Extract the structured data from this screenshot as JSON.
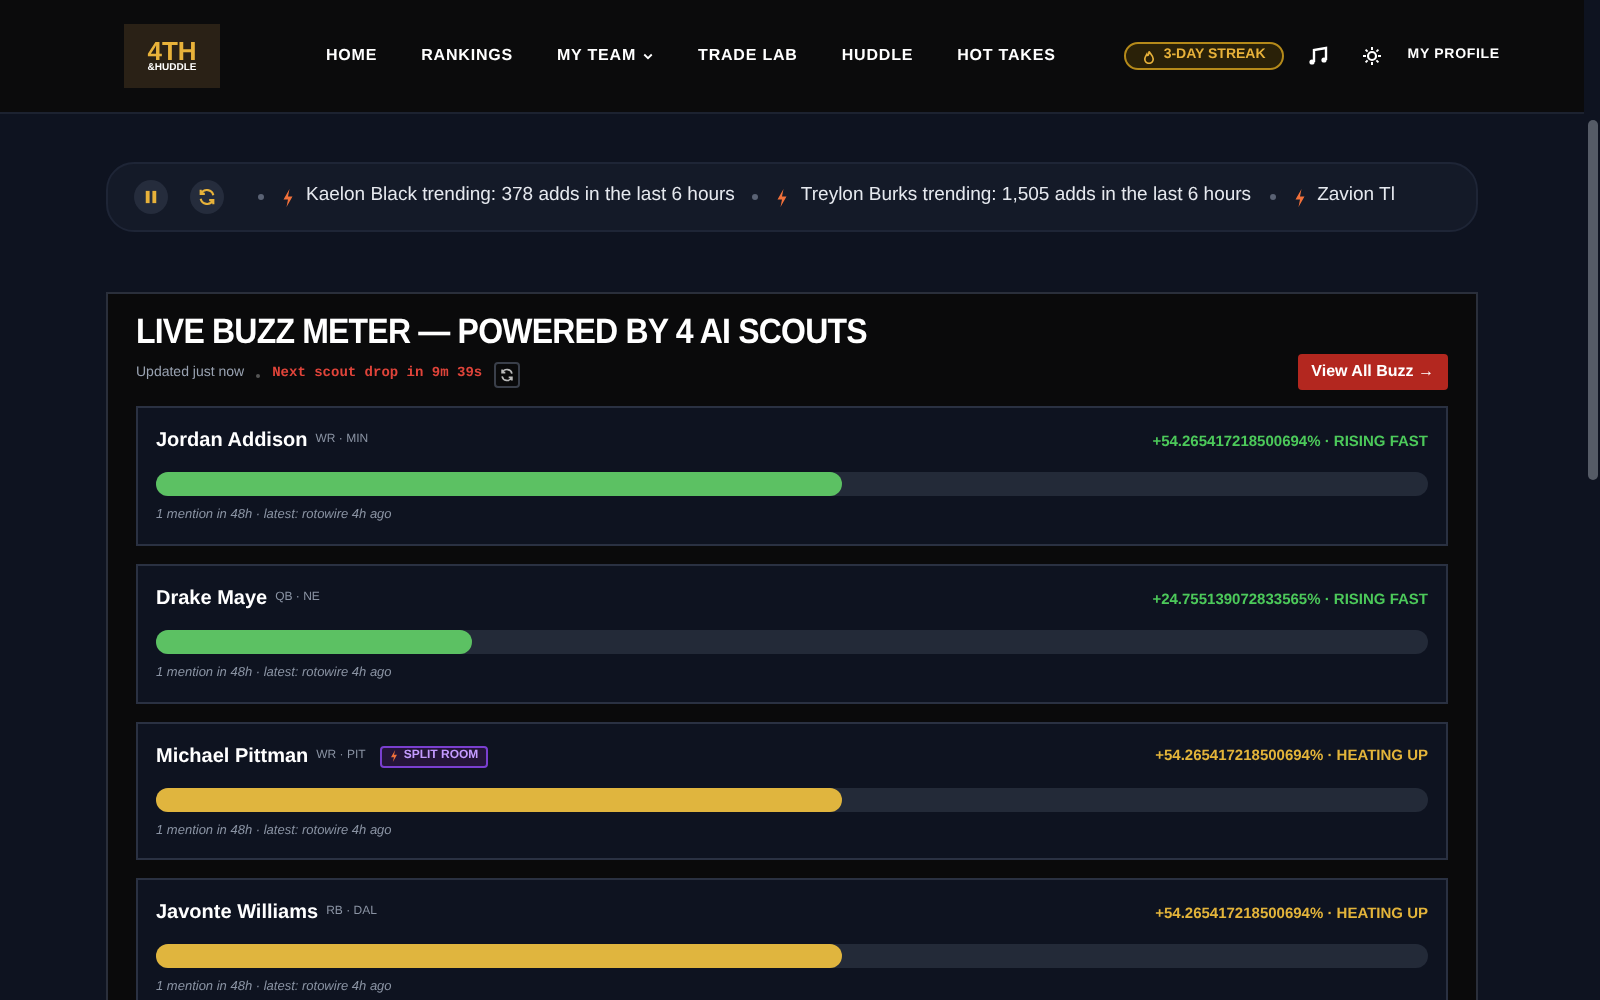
{
  "logo": {
    "line_1": "4TH",
    "line_2": "&HUDDLE"
  },
  "nav": [
    {
      "label": "HOME",
      "dropdown": false
    },
    {
      "label": "RANKINGS",
      "dropdown": false
    },
    {
      "label": "MY TEAM",
      "dropdown": true
    },
    {
      "label": "TRADE LAB",
      "dropdown": false
    },
    {
      "label": "HUDDLE",
      "dropdown": false
    },
    {
      "label": "HOT TAKES",
      "dropdown": false
    }
  ],
  "streak": "3-DAY STREAK",
  "profile": "MY PROFILE",
  "ticker": [
    {
      "text": "Kaelon Black trending: 378 adds in the last 6 hours"
    },
    {
      "text": "Treylon Burks trending: 1,505 adds in the last 6 hours"
    },
    {
      "text": "Zavion Tl"
    }
  ],
  "panel": {
    "title": "LIVE BUZZ METER — POWERED BY 4 AI SCOUTS",
    "updated": "Updated just now",
    "countdown": "Next scout drop in 9m 39s",
    "button": "View All Buzz →",
    "players": [
      {
        "name": "Jordan Addison",
        "pos": "WR · MIN",
        "change": "+54.265417218500694% · RISING FAST",
        "kind": "rising",
        "level": 0.54,
        "note": "1 mention in 48h · latest: rotowire 4h ago"
      },
      {
        "name": "Drake Maye",
        "pos": "QB · NE",
        "change": "+24.755139072833565% · RISING FAST",
        "kind": "rising",
        "level": 0.248,
        "note": "1 mention in 48h · latest: rotowire 4h ago"
      },
      {
        "name": "Michael Pittman",
        "pos": "WR · PIT",
        "badge": "SPLIT ROOM",
        "change": "+54.265417218500694% · HEATING UP",
        "kind": "heating",
        "level": 0.54,
        "note": "1 mention in 48h · latest: rotowire 4h ago"
      },
      {
        "name": "Javonte Williams",
        "pos": "RB · DAL",
        "change": "+54.265417218500694% · HEATING UP",
        "kind": "heating",
        "level": 0.54,
        "note": "1 mention in 48h · latest: rotowire 4h ago"
      }
    ]
  }
}
